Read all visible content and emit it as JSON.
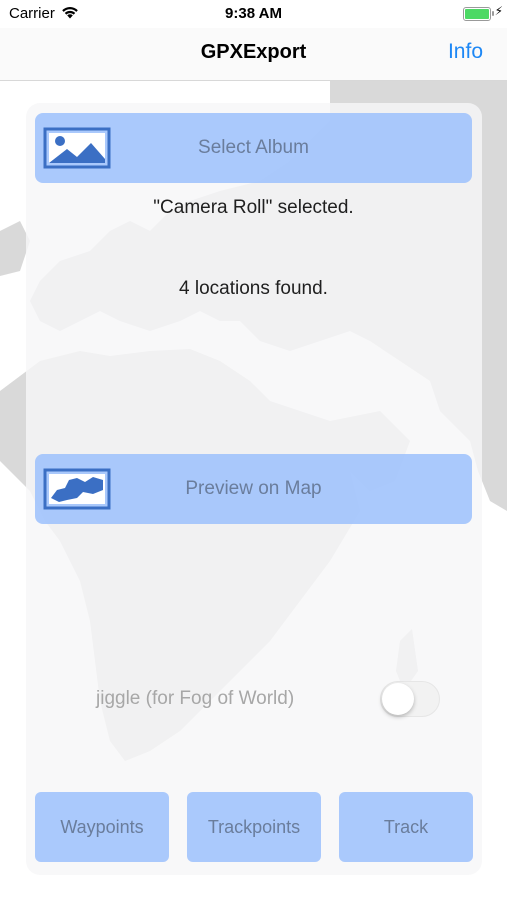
{
  "status_bar": {
    "carrier": "Carrier",
    "time": "9:38 AM"
  },
  "nav": {
    "title": "GPXExport",
    "info_label": "Info"
  },
  "album": {
    "select_button_label": "Select Album",
    "selected_text": "\"Camera Roll\" selected.",
    "locations_text": "4 locations found."
  },
  "preview": {
    "button_label": "Preview on Map"
  },
  "jiggle": {
    "label": "jiggle (for Fog of World)",
    "enabled": false
  },
  "export_buttons": {
    "waypoints": "Waypoints",
    "trackpoints": "Trackpoints",
    "track": "Track"
  },
  "colors": {
    "accent": "#1e88f5",
    "button_fill": "#98befc",
    "button_text": "#6a7d9c"
  }
}
